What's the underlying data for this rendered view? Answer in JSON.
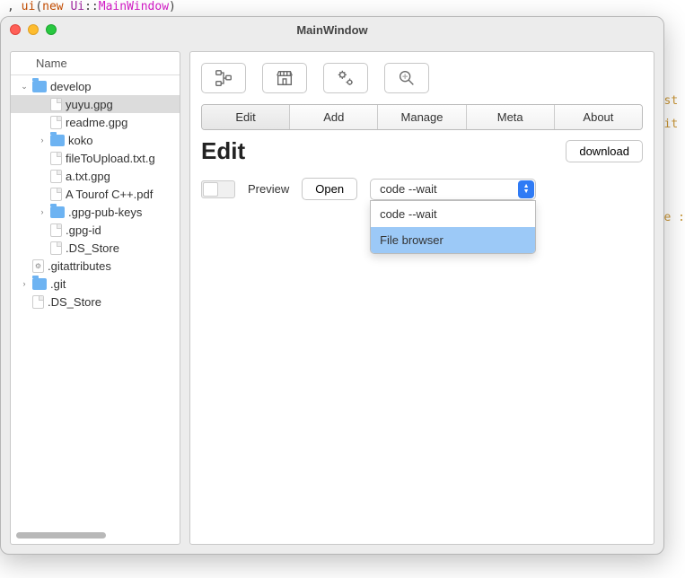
{
  "code_line": {
    "prefix": ", ",
    "kw": "ui",
    "paren1": "(",
    "new": "new ",
    "ns": "Ui",
    "sep": "::",
    "cls": "MainWindow",
    "paren2": ")"
  },
  "window": {
    "title": "MainWindow"
  },
  "sidebar": {
    "header": "Name",
    "items": [
      {
        "type": "folder",
        "label": "develop",
        "depth": 1,
        "arrow": "down"
      },
      {
        "type": "file",
        "label": "yuyu.gpg",
        "depth": 2,
        "selected": true
      },
      {
        "type": "file",
        "label": "readme.gpg",
        "depth": 2
      },
      {
        "type": "folder",
        "label": "koko",
        "depth": 2,
        "arrow": "right"
      },
      {
        "type": "file",
        "label": "fileToUpload.txt.g",
        "depth": 2
      },
      {
        "type": "file",
        "label": "a.txt.gpg",
        "depth": 2
      },
      {
        "type": "file",
        "label": "A Tourof C++.pdf",
        "depth": 2
      },
      {
        "type": "folder",
        "label": ".gpg-pub-keys",
        "depth": 2,
        "arrow": "right"
      },
      {
        "type": "file",
        "label": ".gpg-id",
        "depth": 2
      },
      {
        "type": "file",
        "label": ".DS_Store",
        "depth": 2
      },
      {
        "type": "gearfile",
        "label": ".gitattributes",
        "depth": 1,
        "arrow": "hidden"
      },
      {
        "type": "folder",
        "label": ".git",
        "depth": 1,
        "arrow": "right"
      },
      {
        "type": "file",
        "label": ".DS_Store",
        "depth": 1,
        "arrow": "hidden"
      }
    ]
  },
  "tabs": [
    "Edit",
    "Add",
    "Manage",
    "Meta",
    "About"
  ],
  "active_tab": "Edit",
  "heading": "Edit",
  "download_label": "download",
  "preview_label": "Preview",
  "open_label": "Open",
  "combo_selected": "code --wait",
  "combo_options": [
    "code --wait",
    "File browser"
  ],
  "combo_highlight": "File browser",
  "bg_fragments": [
    "st",
    "it",
    "",
    "",
    "",
    "e :"
  ]
}
